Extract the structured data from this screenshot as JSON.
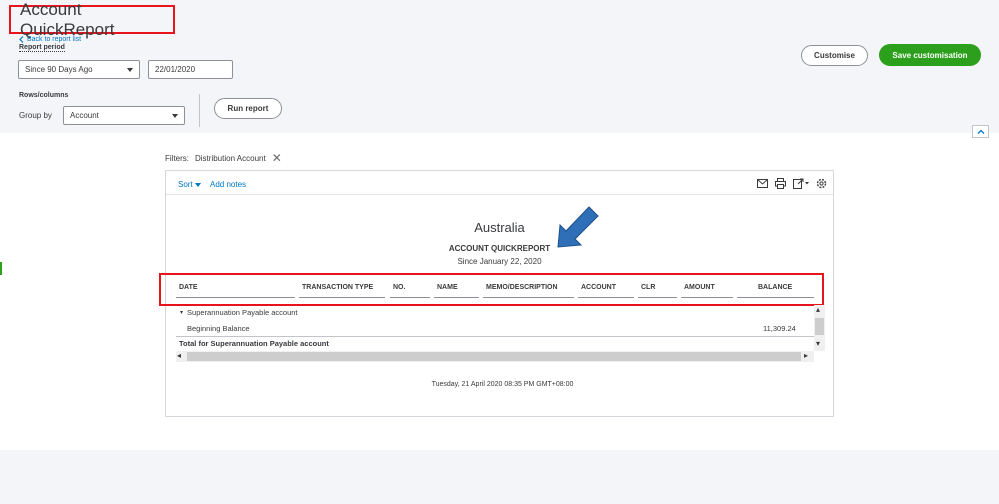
{
  "header": {
    "title": "Account QuickReport",
    "back_link": "Back to report list",
    "report_period_label": "Report period",
    "period_value": "Since 90 Days Ago",
    "date_value": "22/01/2020",
    "rows_columns_label": "Rows/columns",
    "group_by_label": "Group by",
    "group_by_value": "Account",
    "run_report": "Run report",
    "customise": "Customise",
    "save_customisation": "Save customisation"
  },
  "filters": {
    "label": "Filters:",
    "value": "Distribution Account"
  },
  "toolbar": {
    "sort": "Sort",
    "add_notes": "Add notes",
    "icons": [
      "email-icon",
      "print-icon",
      "export-icon",
      "settings-icon"
    ]
  },
  "report": {
    "company": "Australia",
    "title": "ACCOUNT QUICKREPORT",
    "subtitle": "Since January 22, 2020",
    "columns": [
      "DATE",
      "TRANSACTION TYPE",
      "NO.",
      "NAME",
      "MEMO/DESCRIPTION",
      "ACCOUNT",
      "CLR",
      "AMOUNT",
      "BALANCE"
    ],
    "group_name": "Superannuation Payable account",
    "beginning_balance_label": "Beginning Balance",
    "beginning_balance_value": "11,309.24",
    "total_label": "Total for Superannuation Payable account",
    "timestamp": "Tuesday, 21 April 2020  08:35 PM GMT+08:00"
  },
  "colors": {
    "accent_blue": "#0077c5",
    "primary_green": "#2ca01c",
    "highlight_red": "#e8141b",
    "annotation_arrow": "#2f6fb8"
  }
}
